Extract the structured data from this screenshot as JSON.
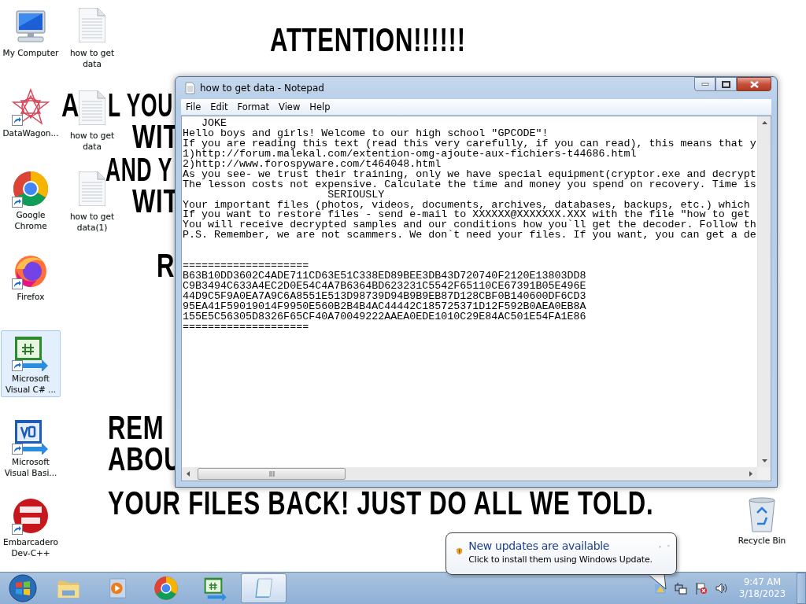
{
  "wallpaper_texts": [
    {
      "text": "ATTENTION!!!!!!"
    },
    {
      "text": "A"
    },
    {
      "text": "L YOU"
    },
    {
      "text": "WIT"
    },
    {
      "text": "AND Y"
    },
    {
      "text": "WIT"
    },
    {
      "text": "R"
    },
    {
      "text": "REM"
    },
    {
      "text": "ABOU"
    },
    {
      "text": "YOUR FILES BACK! JUST DO ALL WE TOLD."
    }
  ],
  "desktop_icons": [
    {
      "label": "My Computer",
      "kind": "computer",
      "shortcut": false,
      "selected": false
    },
    {
      "label": "DataWagon...",
      "kind": "star",
      "shortcut": true,
      "selected": false
    },
    {
      "label": "Google Chrome",
      "kind": "chrome",
      "shortcut": true,
      "selected": false
    },
    {
      "label": "Firefox",
      "kind": "firefox",
      "shortcut": true,
      "selected": false
    },
    {
      "label": "Microsoft Visual C# ...",
      "kind": "csharp",
      "shortcut": true,
      "selected": true
    },
    {
      "label": "Microsoft Visual Basi...",
      "kind": "vb",
      "shortcut": true,
      "selected": false
    },
    {
      "label": "Embarcadero Dev-C++",
      "kind": "devcpp",
      "shortcut": true,
      "selected": false
    },
    {
      "label": "how to get data",
      "kind": "textfile",
      "shortcut": false,
      "selected": false
    },
    {
      "label": "how to get data",
      "kind": "textfile",
      "shortcut": false,
      "selected": false
    },
    {
      "label": "how to get data(1)",
      "kind": "textfile",
      "shortcut": false,
      "selected": false
    },
    {
      "label": "Recycle Bin",
      "kind": "recycle",
      "shortcut": false,
      "selected": false
    }
  ],
  "notepad": {
    "title": "how to get data - Notepad",
    "menu": [
      "File",
      "Edit",
      "Format",
      "View",
      "Help"
    ],
    "body_lines": [
      "   JOKE",
      "Hello boys and girls! Welcome to our high school \"GPCODE\"!",
      "If you are reading this text (read this very carefully, if you can read), this means that y",
      "1)http://forum.malekal.com/extention-omg-ajoute-aux-fichiers-t44686.html",
      "2)http://www.forospyware.com/t464048.html",
      "As you see- we trust their training, only we have special equipment(cryptor.exe and decrypt",
      "The lesson costs not expensive. Calculate the time and money you spend on recovery. Time is",
      "                       SERIOUSLY",
      "Your important files (photos, videos, documents, archives, databases, backups, etc.) which",
      "If you want to restore files - send e-mail to XXXXXX@XXXXXXX.XXX with the file \"how to get",
      "You will receive decrypted samples and our conditions how you`ll get the decoder. Follow th",
      "P.S. Remember, we are not scammers. We don`t need your files. If you want, you can get a de"
    ],
    "key_lines": [
      "====================",
      "B63B10DD3602C4ADE711CD63E51C338ED89BEE3DB43D720740F2120E13803DD8",
      "C9B3494C633A4EC2D0E54C4A7B6364BD623231C5542F65110CE67391B05E496E",
      "44D9C5F9A0EA7A9C6A8551E513D98739D94B9B9EB87D128CBF0B140600DF6CD3",
      "95EA41F59019014F9950E560B2B4B4AC44442C185725371D12F592B0AEA0EB8A",
      "155E5C56305D8326F65CF40A70049222AAEA0EDE1010C29E84AC501E54FA1E86",
      "===================="
    ]
  },
  "notification": {
    "title": "New updates are available",
    "message": "Click to install them using Windows Update."
  },
  "taskbar": {
    "buttons": [
      {
        "kind": "explorer",
        "selected": false
      },
      {
        "kind": "media",
        "selected": false
      },
      {
        "kind": "chrome",
        "selected": false
      },
      {
        "kind": "csharp",
        "selected": false
      },
      {
        "kind": "notepad",
        "selected": true
      }
    ],
    "clock": {
      "time": "9:47 AM",
      "date": "3/18/2023"
    }
  }
}
